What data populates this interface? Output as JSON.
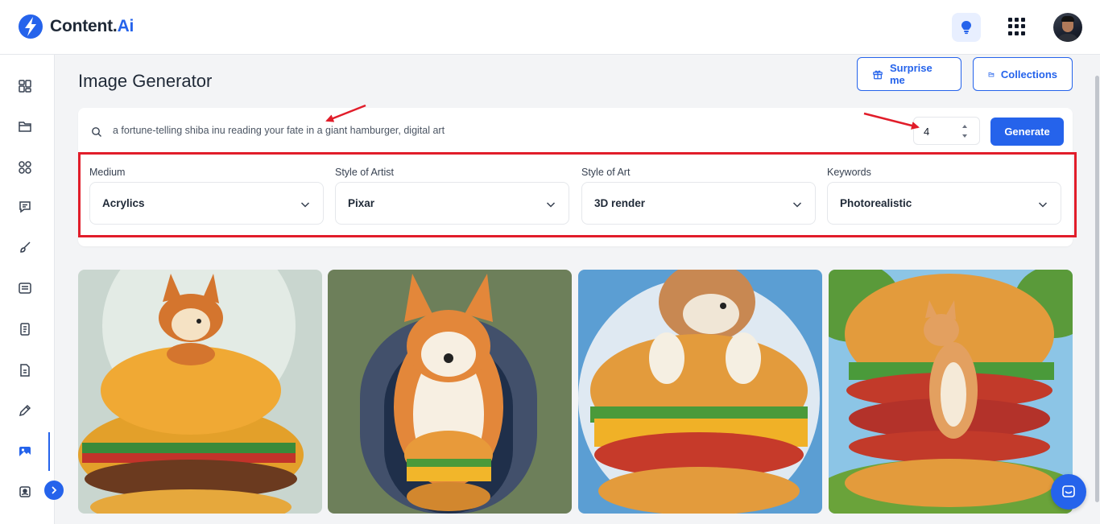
{
  "app": {
    "logo_text": "Content.",
    "logo_accent": "Ai",
    "brand_color": "#2563eb"
  },
  "header": {
    "icons": [
      "lightbulb-icon",
      "apps-grid-icon",
      "user-avatar"
    ]
  },
  "sidebar": {
    "items": [
      {
        "icon": "dashboard-icon"
      },
      {
        "icon": "folder-icon"
      },
      {
        "icon": "templates-icon"
      },
      {
        "icon": "chat-icon"
      },
      {
        "icon": "brush-icon"
      },
      {
        "icon": "article-icon"
      },
      {
        "icon": "document-icon"
      },
      {
        "icon": "report-icon"
      },
      {
        "icon": "pencil-icon"
      },
      {
        "icon": "image-generator-icon",
        "active": true
      },
      {
        "icon": "badge-icon"
      }
    ]
  },
  "page": {
    "title": "Image Generator",
    "surprise_label": "Surprise me",
    "collections_label": "Collections"
  },
  "generator": {
    "prompt": "a fortune-telling shiba inu reading your fate in a giant hamburger, digital art",
    "count": "4",
    "generate_label": "Generate"
  },
  "filters": [
    {
      "label": "Medium",
      "value": "Acrylics"
    },
    {
      "label": "Style of Artist",
      "value": "Pixar"
    },
    {
      "label": "Style of Art",
      "value": "3D render"
    },
    {
      "label": "Keywords",
      "value": "Photorealistic"
    }
  ],
  "results": [
    {
      "description": "generated-image-1"
    },
    {
      "description": "generated-image-2"
    },
    {
      "description": "generated-image-3"
    },
    {
      "description": "generated-image-4"
    }
  ],
  "colors": {
    "highlight": "#e11d2a",
    "annotation_arrow": "#e11d2a"
  }
}
